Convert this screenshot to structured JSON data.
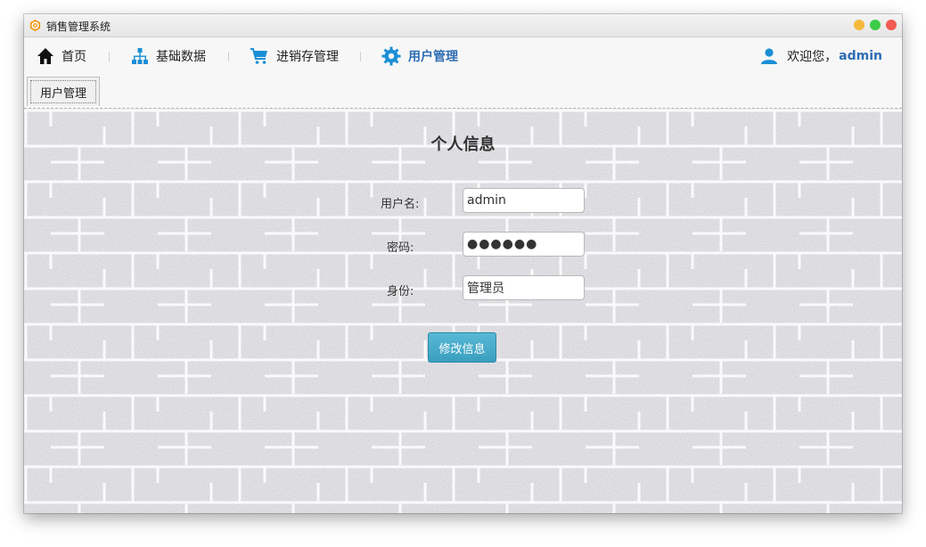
{
  "window": {
    "title": "销售管理系统"
  },
  "navbar": {
    "items": [
      {
        "label": "首页",
        "icon": "home-icon"
      },
      {
        "label": "基础数据",
        "icon": "sitemap-icon"
      },
      {
        "label": "进销存管理",
        "icon": "cart-icon"
      },
      {
        "label": "用户管理",
        "icon": "gear-icon",
        "active": true
      }
    ],
    "welcome": "欢迎您，",
    "username": "admin"
  },
  "tabs": [
    {
      "label": "用户管理"
    }
  ],
  "form": {
    "title": "个人信息",
    "username_label": "用户名:",
    "username_value": "admin",
    "password_label": "密码:",
    "password_value": "●●●●●●",
    "role_label": "身份:",
    "role_value": "管理员",
    "submit_label": "修改信息"
  },
  "colors": {
    "accent": "#2e6db4",
    "nav_icon": "#1b8fd6",
    "button": "#3a9fbe"
  }
}
